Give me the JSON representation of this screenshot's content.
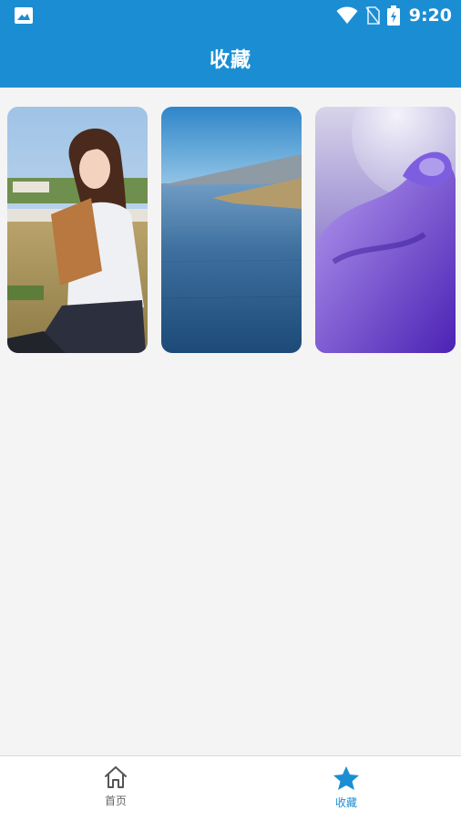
{
  "status_bar": {
    "time": "9:20"
  },
  "header": {
    "title": "收藏"
  },
  "favorites": [
    {
      "name": "girl-photo"
    },
    {
      "name": "lake-photo"
    },
    {
      "name": "purple-abstract"
    }
  ],
  "bottom_nav": {
    "items": [
      {
        "label": "首页",
        "icon": "home-icon",
        "active": false
      },
      {
        "label": "收藏",
        "icon": "star-icon",
        "active": true
      }
    ]
  },
  "colors": {
    "primary": "#1b8ed3",
    "background": "#f4f4f4",
    "inactive": "#666666"
  }
}
